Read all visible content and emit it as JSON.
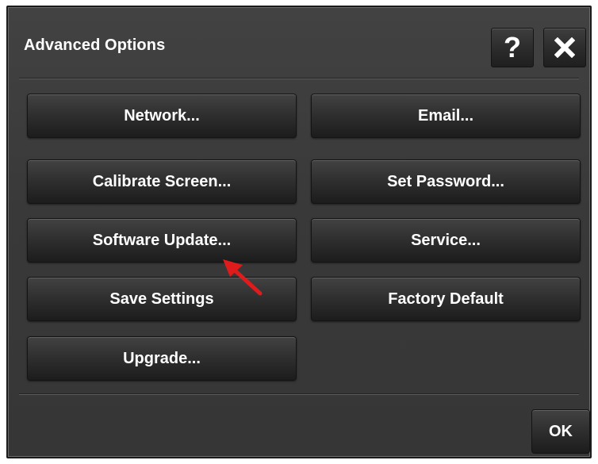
{
  "dialog": {
    "title": "Advanced Options",
    "help_label": "?",
    "buttons": {
      "network": "Network...",
      "email": "Email...",
      "calibrate_screen": "Calibrate Screen...",
      "set_password": "Set Password...",
      "software_update": "Software Update...",
      "service": "Service...",
      "save_settings": "Save Settings",
      "factory_default": "Factory Default",
      "upgrade": "Upgrade..."
    },
    "ok_label": "OK"
  },
  "icons": {
    "help": "question-icon",
    "close": "close-icon",
    "annotation": "red-arrow-icon"
  },
  "colors": {
    "panel": "#393939",
    "button": "#2e2e2e",
    "text": "#ffffff",
    "annotation": "#e01b1b"
  }
}
